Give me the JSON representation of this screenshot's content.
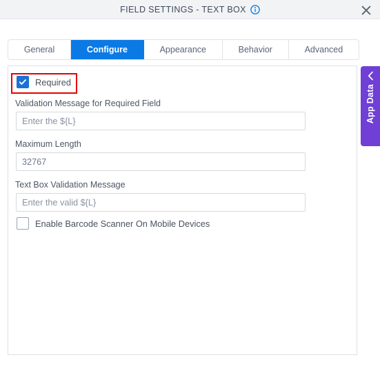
{
  "header": {
    "title": "FIELD SETTINGS - TEXT BOX",
    "info_icon": "info-circle-icon",
    "close_icon": "close-icon"
  },
  "tabs": [
    {
      "label": "General",
      "active": false
    },
    {
      "label": "Configure",
      "active": true
    },
    {
      "label": "Appearance",
      "active": false
    },
    {
      "label": "Behavior",
      "active": false
    },
    {
      "label": "Advanced",
      "active": false
    }
  ],
  "form": {
    "required_checkbox": {
      "label": "Required",
      "checked": true,
      "highlighted": true
    },
    "validation_message_required": {
      "label": "Validation Message for Required Field",
      "value": "",
      "placeholder": "Enter the ${L}"
    },
    "maximum_length": {
      "label": "Maximum Length",
      "value": "32767",
      "placeholder": "32767"
    },
    "text_box_validation_message": {
      "label": "Text Box Validation Message",
      "value": "",
      "placeholder": "Enter the valid ${L}"
    },
    "barcode_checkbox": {
      "label": "Enable Barcode Scanner On Mobile Devices",
      "checked": false
    }
  },
  "app_data_tab": {
    "label": "App Data",
    "chevron_icon": "chevron-left-icon"
  },
  "colors": {
    "accent_blue": "#0b7ae5",
    "checkbox_blue": "#1a73d4",
    "highlight_red": "#e40000",
    "app_data_purple": "#6f3fd6",
    "header_grey": "#f2f3f5"
  }
}
